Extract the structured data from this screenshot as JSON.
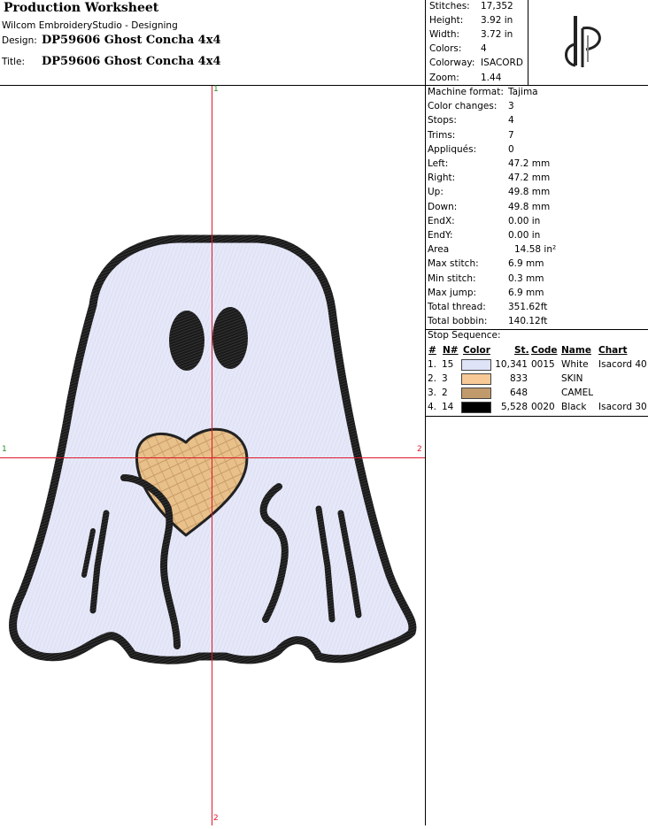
{
  "header": {
    "title": "Production Worksheet",
    "software": "Wilcom EmbroideryStudio - Designing",
    "design_label": "Design:",
    "design_value": "DP59606 Ghost Concha 4x4",
    "title_label": "Title:",
    "title_value": "DP59606 Ghost Concha 4x4"
  },
  "stats": [
    {
      "key": "Stitches:",
      "value": "17,352"
    },
    {
      "key": "Height:",
      "value": "3.92 in"
    },
    {
      "key": "Width:",
      "value": "3.72 in"
    },
    {
      "key": "Colors:",
      "value": "4"
    },
    {
      "key": "Colorway:",
      "value": "ISACORD"
    },
    {
      "key": "Zoom:",
      "value": "1.44"
    }
  ],
  "logo": {
    "text": "dP",
    "icon": "monogram-logo"
  },
  "machine": [
    {
      "key": "Machine format:",
      "value": "Tajima"
    },
    {
      "key": "Color changes:",
      "value": "3"
    },
    {
      "key": "Stops:",
      "value": "4"
    },
    {
      "key": "Trims:",
      "value": "7"
    },
    {
      "key": "Appliqués:",
      "value": "0"
    },
    {
      "key": "Left:",
      "value": "47.2 mm"
    },
    {
      "key": "Right:",
      "value": "47.2 mm"
    },
    {
      "key": "Up:",
      "value": "49.8 mm"
    },
    {
      "key": "Down:",
      "value": "49.8 mm"
    },
    {
      "key": "EndX:",
      "value": "0.00 in"
    },
    {
      "key": "EndY:",
      "value": "0.00 in"
    },
    {
      "key": "Area",
      "value": "14.58 in²"
    },
    {
      "key": "Max stitch:",
      "value": "6.9 mm"
    },
    {
      "key": "Min stitch:",
      "value": "0.3 mm"
    },
    {
      "key": "Max jump:",
      "value": "6.9 mm"
    },
    {
      "key": "Total thread:",
      "value": "351.62ft"
    },
    {
      "key": "Total bobbin:",
      "value": "140.12ft"
    }
  ],
  "stop_sequence": {
    "title": "Stop Sequence:",
    "headers": {
      "num": "#",
      "n": "N#",
      "color": "Color",
      "st": "St.",
      "code": "Code",
      "name": "Name",
      "chart": "Chart"
    },
    "rows": [
      {
        "num": "1.",
        "n": "15",
        "color": "#dfe3f8",
        "st": "10,341",
        "code": "0015",
        "name": "White",
        "chart": "Isacord 40"
      },
      {
        "num": "2.",
        "n": "3",
        "color": "#f7c996",
        "st": "833",
        "code": "",
        "name": "SKIN",
        "chart": ""
      },
      {
        "num": "3.",
        "n": "2",
        "color": "#c19a6b",
        "st": "648",
        "code": "",
        "name": "CAMEL",
        "chart": ""
      },
      {
        "num": "4.",
        "n": "14",
        "color": "#000000",
        "st": "5,528",
        "code": "0020",
        "name": "Black",
        "chart": "Isacord 30"
      }
    ]
  },
  "canvas": {
    "axis_top": "1",
    "axis_bottom": "2",
    "axis_left": "1",
    "axis_right": "2",
    "axis_color": "#e0182d",
    "fill_color": "#e6e8f8",
    "outline_color": "#111111",
    "heart_color": "#e8c08a",
    "heart_stripe": "#c79a66"
  }
}
